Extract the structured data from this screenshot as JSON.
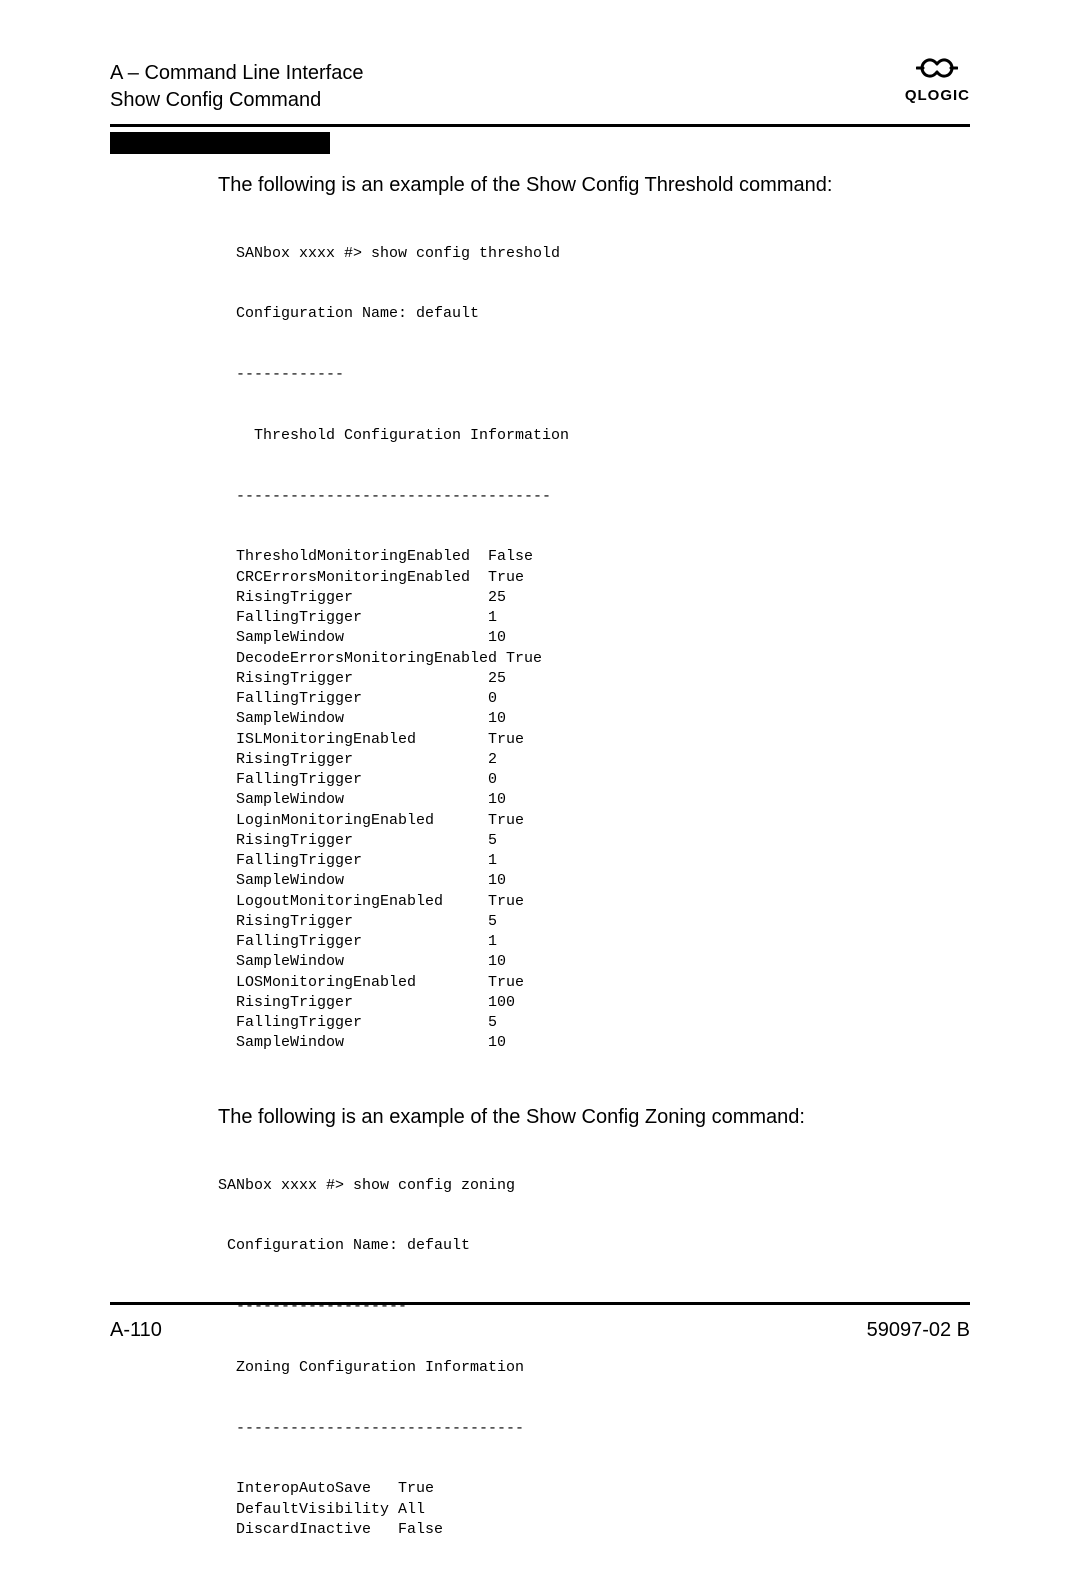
{
  "header": {
    "line1": "A – Command Line Interface",
    "line2": "Show Config Command",
    "brand": "QLOGIC"
  },
  "section1": {
    "intro": "The following is an example of the Show Config Threshold command:",
    "cmd": "SANbox xxxx #> show config threshold",
    "confName": "Configuration Name: default",
    "dashA": "------------",
    "title": "  Threshold Configuration Information",
    "dashB": "-----------------------------------",
    "rows": [
      {
        "k": "ThresholdMonitoringEnabled",
        "v": "False"
      },
      {
        "k": "CRCErrorsMonitoringEnabled",
        "v": "True"
      },
      {
        "k": "RisingTrigger",
        "v": "25"
      },
      {
        "k": "FallingTrigger",
        "v": "1"
      },
      {
        "k": "SampleWindow",
        "v": "10"
      },
      {
        "k": "DecodeErrorsMonitoringEnabled",
        "v": "True",
        "tight": true
      },
      {
        "k": "RisingTrigger",
        "v": "25"
      },
      {
        "k": "FallingTrigger",
        "v": "0"
      },
      {
        "k": "SampleWindow",
        "v": "10"
      },
      {
        "k": "ISLMonitoringEnabled",
        "v": "True"
      },
      {
        "k": "RisingTrigger",
        "v": "2"
      },
      {
        "k": "FallingTrigger",
        "v": "0"
      },
      {
        "k": "SampleWindow",
        "v": "10"
      },
      {
        "k": "LoginMonitoringEnabled",
        "v": "True"
      },
      {
        "k": "RisingTrigger",
        "v": "5"
      },
      {
        "k": "FallingTrigger",
        "v": "1"
      },
      {
        "k": "SampleWindow",
        "v": "10"
      },
      {
        "k": "LogoutMonitoringEnabled",
        "v": "True"
      },
      {
        "k": "RisingTrigger",
        "v": "5"
      },
      {
        "k": "FallingTrigger",
        "v": "1"
      },
      {
        "k": "SampleWindow",
        "v": "10"
      },
      {
        "k": "LOSMonitoringEnabled",
        "v": "True"
      },
      {
        "k": "RisingTrigger",
        "v": "100"
      },
      {
        "k": "FallingTrigger",
        "v": "5"
      },
      {
        "k": "SampleWindow",
        "v": "10"
      }
    ]
  },
  "section2": {
    "intro": "The following is an example of the Show Config Zoning command:",
    "cmd": "SANbox xxxx #> show config zoning",
    "confName": " Configuration Name: default",
    "dashA": "  -------------------",
    "title": "  Zoning Configuration Information",
    "dashB": "  --------------------------------",
    "rows": [
      {
        "k": "InteropAutoSave",
        "v": "True"
      },
      {
        "k": "DefaultVisibility",
        "v": "All"
      },
      {
        "k": "DiscardInactive",
        "v": "False"
      }
    ]
  },
  "footer": {
    "page": "A-110",
    "doc": "59097-02 B"
  }
}
